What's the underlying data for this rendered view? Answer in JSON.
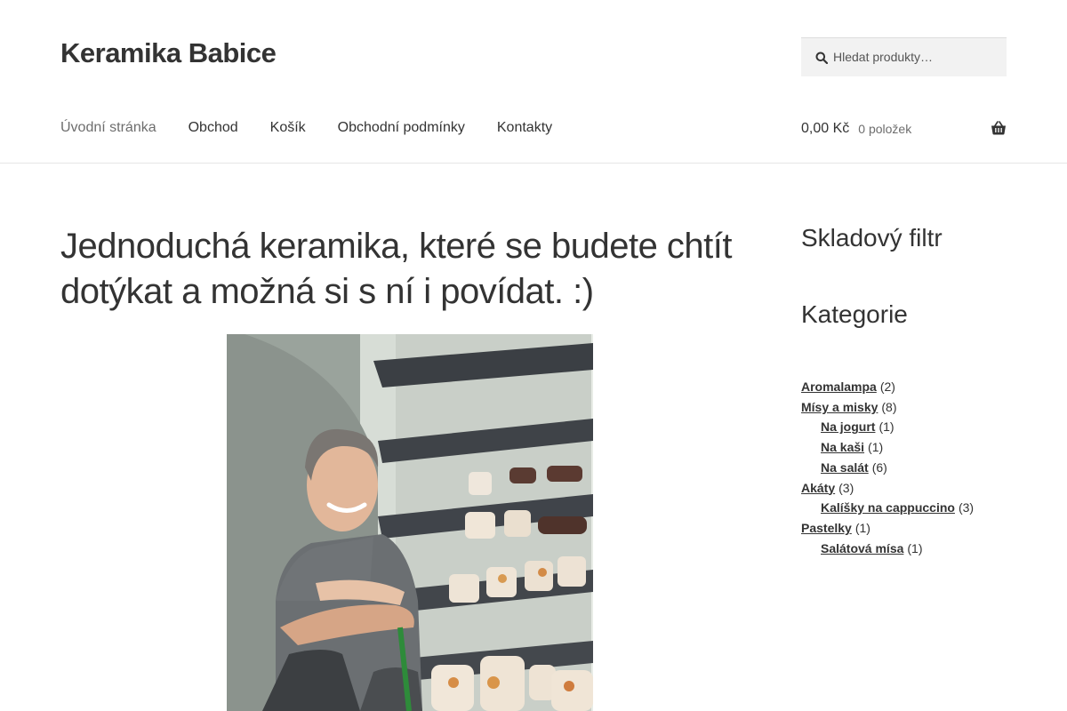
{
  "site": {
    "title": "Keramika Babice"
  },
  "search": {
    "placeholder": "Hledat produkty…",
    "value": ""
  },
  "nav": {
    "items": [
      {
        "label": "Úvodní stránka"
      },
      {
        "label": "Obchod"
      },
      {
        "label": "Košík"
      },
      {
        "label": "Obchodní podmínky"
      },
      {
        "label": "Kontakty"
      }
    ]
  },
  "cart": {
    "amount": "0,00 Kč",
    "count": "0 položek"
  },
  "main": {
    "heading": "Jednoduchá keramika, které se budete chtít dotýkat a možná si s ní i povídat. :)"
  },
  "sidebar": {
    "stock_filter_title": "Skladový filtr",
    "categories_title": "Kategorie",
    "categories": [
      {
        "name": "Aromalampa",
        "count": "(2)"
      },
      {
        "name": "Mísy a misky",
        "count": "(8)"
      },
      {
        "name": "Na jogurt",
        "count": "(1)"
      },
      {
        "name": "Na kaši",
        "count": "(1)"
      },
      {
        "name": "Na salát",
        "count": "(6)"
      },
      {
        "name": "Akáty",
        "count": "(3)"
      },
      {
        "name": "Kalíšky na cappuccino",
        "count": "(3)"
      },
      {
        "name": "Pastelky",
        "count": "(1)"
      },
      {
        "name": "Salátová mísa",
        "count": "(1)"
      }
    ]
  },
  "colors": {
    "text": "#333333",
    "muted": "#6d6d6d",
    "search_bg": "#f2f2f2",
    "divider": "#e6e6e6"
  },
  "icons": {
    "search": "search-icon",
    "cart": "shopping-basket-icon"
  }
}
